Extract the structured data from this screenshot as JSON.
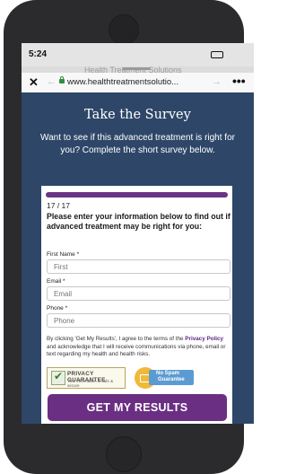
{
  "status_bar": {
    "time": "5:24"
  },
  "browser": {
    "url": "www.healthtreatmentsolutio...",
    "close_glyph": "✕",
    "back_glyph": "←",
    "forward_glyph": "→",
    "more_glyph": "•••",
    "tab_peek_text": "Health Treatment Solutions"
  },
  "hero": {
    "title": "Take the Survey",
    "subtitle": "Want to see if this advanced treatment is right for you? Complete the short survey below."
  },
  "form": {
    "progress_fraction": 1.0,
    "step": "17 / 17",
    "question": "Please enter your information below to find out if advanced treatment may be right for you:",
    "fields": [
      {
        "label": "First Name *",
        "placeholder": "First"
      },
      {
        "label": "Email *",
        "placeholder": "Email"
      },
      {
        "label": "Phone *",
        "placeholder": "Phone"
      }
    ],
    "terms_before": "By clicking 'Get My Results', I agree to the terms of the ",
    "terms_link": "Privacy Policy",
    "terms_after": " and acknowledge that I will receive communications via phone, email or text regarding my health and health risks.",
    "privacy_badge_title": "PRIVACY GUARANTEE",
    "privacy_badge_sub": "Your information is safe & secure",
    "spam_badge_line1": "No Spam",
    "spam_badge_line2": "Guarantee",
    "submit_label": "GET MY RESULTS"
  },
  "colors": {
    "page_background": "#2e4769",
    "accent_purple": "#6a2f83",
    "phone_body": "#2b2b2e"
  }
}
